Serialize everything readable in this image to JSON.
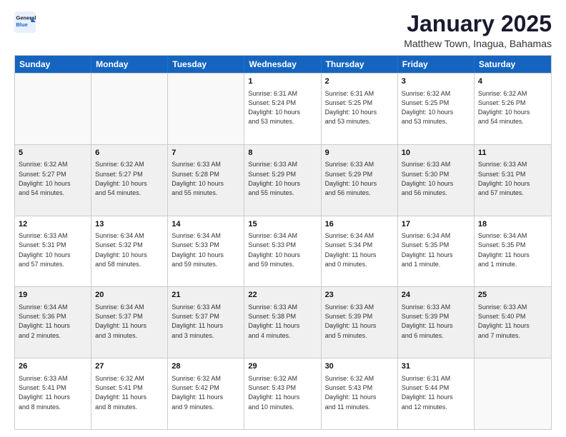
{
  "logo": {
    "line1": "General",
    "line2": "Blue"
  },
  "title": "January 2025",
  "subtitle": "Matthew Town, Inagua, Bahamas",
  "days": [
    "Sunday",
    "Monday",
    "Tuesday",
    "Wednesday",
    "Thursday",
    "Friday",
    "Saturday"
  ],
  "rows": [
    [
      {
        "day": "",
        "info": "",
        "shaded": false,
        "empty": true
      },
      {
        "day": "",
        "info": "",
        "shaded": false,
        "empty": true
      },
      {
        "day": "",
        "info": "",
        "shaded": false,
        "empty": true
      },
      {
        "day": "1",
        "info": "Sunrise: 6:31 AM\nSunset: 5:24 PM\nDaylight: 10 hours\nand 53 minutes.",
        "shaded": false,
        "empty": false
      },
      {
        "day": "2",
        "info": "Sunrise: 6:31 AM\nSunset: 5:25 PM\nDaylight: 10 hours\nand 53 minutes.",
        "shaded": false,
        "empty": false
      },
      {
        "day": "3",
        "info": "Sunrise: 6:32 AM\nSunset: 5:25 PM\nDaylight: 10 hours\nand 53 minutes.",
        "shaded": false,
        "empty": false
      },
      {
        "day": "4",
        "info": "Sunrise: 6:32 AM\nSunset: 5:26 PM\nDaylight: 10 hours\nand 54 minutes.",
        "shaded": false,
        "empty": false
      }
    ],
    [
      {
        "day": "5",
        "info": "Sunrise: 6:32 AM\nSunset: 5:27 PM\nDaylight: 10 hours\nand 54 minutes.",
        "shaded": true,
        "empty": false
      },
      {
        "day": "6",
        "info": "Sunrise: 6:32 AM\nSunset: 5:27 PM\nDaylight: 10 hours\nand 54 minutes.",
        "shaded": true,
        "empty": false
      },
      {
        "day": "7",
        "info": "Sunrise: 6:33 AM\nSunset: 5:28 PM\nDaylight: 10 hours\nand 55 minutes.",
        "shaded": true,
        "empty": false
      },
      {
        "day": "8",
        "info": "Sunrise: 6:33 AM\nSunset: 5:29 PM\nDaylight: 10 hours\nand 55 minutes.",
        "shaded": true,
        "empty": false
      },
      {
        "day": "9",
        "info": "Sunrise: 6:33 AM\nSunset: 5:29 PM\nDaylight: 10 hours\nand 56 minutes.",
        "shaded": true,
        "empty": false
      },
      {
        "day": "10",
        "info": "Sunrise: 6:33 AM\nSunset: 5:30 PM\nDaylight: 10 hours\nand 56 minutes.",
        "shaded": true,
        "empty": false
      },
      {
        "day": "11",
        "info": "Sunrise: 6:33 AM\nSunset: 5:31 PM\nDaylight: 10 hours\nand 57 minutes.",
        "shaded": true,
        "empty": false
      }
    ],
    [
      {
        "day": "12",
        "info": "Sunrise: 6:33 AM\nSunset: 5:31 PM\nDaylight: 10 hours\nand 57 minutes.",
        "shaded": false,
        "empty": false
      },
      {
        "day": "13",
        "info": "Sunrise: 6:34 AM\nSunset: 5:32 PM\nDaylight: 10 hours\nand 58 minutes.",
        "shaded": false,
        "empty": false
      },
      {
        "day": "14",
        "info": "Sunrise: 6:34 AM\nSunset: 5:33 PM\nDaylight: 10 hours\nand 59 minutes.",
        "shaded": false,
        "empty": false
      },
      {
        "day": "15",
        "info": "Sunrise: 6:34 AM\nSunset: 5:33 PM\nDaylight: 10 hours\nand 59 minutes.",
        "shaded": false,
        "empty": false
      },
      {
        "day": "16",
        "info": "Sunrise: 6:34 AM\nSunset: 5:34 PM\nDaylight: 11 hours\nand 0 minutes.",
        "shaded": false,
        "empty": false
      },
      {
        "day": "17",
        "info": "Sunrise: 6:34 AM\nSunset: 5:35 PM\nDaylight: 11 hours\nand 1 minute.",
        "shaded": false,
        "empty": false
      },
      {
        "day": "18",
        "info": "Sunrise: 6:34 AM\nSunset: 5:35 PM\nDaylight: 11 hours\nand 1 minute.",
        "shaded": false,
        "empty": false
      }
    ],
    [
      {
        "day": "19",
        "info": "Sunrise: 6:34 AM\nSunset: 5:36 PM\nDaylight: 11 hours\nand 2 minutes.",
        "shaded": true,
        "empty": false
      },
      {
        "day": "20",
        "info": "Sunrise: 6:34 AM\nSunset: 5:37 PM\nDaylight: 11 hours\nand 3 minutes.",
        "shaded": true,
        "empty": false
      },
      {
        "day": "21",
        "info": "Sunrise: 6:33 AM\nSunset: 5:37 PM\nDaylight: 11 hours\nand 3 minutes.",
        "shaded": true,
        "empty": false
      },
      {
        "day": "22",
        "info": "Sunrise: 6:33 AM\nSunset: 5:38 PM\nDaylight: 11 hours\nand 4 minutes.",
        "shaded": true,
        "empty": false
      },
      {
        "day": "23",
        "info": "Sunrise: 6:33 AM\nSunset: 5:39 PM\nDaylight: 11 hours\nand 5 minutes.",
        "shaded": true,
        "empty": false
      },
      {
        "day": "24",
        "info": "Sunrise: 6:33 AM\nSunset: 5:39 PM\nDaylight: 11 hours\nand 6 minutes.",
        "shaded": true,
        "empty": false
      },
      {
        "day": "25",
        "info": "Sunrise: 6:33 AM\nSunset: 5:40 PM\nDaylight: 11 hours\nand 7 minutes.",
        "shaded": true,
        "empty": false
      }
    ],
    [
      {
        "day": "26",
        "info": "Sunrise: 6:33 AM\nSunset: 5:41 PM\nDaylight: 11 hours\nand 8 minutes.",
        "shaded": false,
        "empty": false
      },
      {
        "day": "27",
        "info": "Sunrise: 6:32 AM\nSunset: 5:41 PM\nDaylight: 11 hours\nand 8 minutes.",
        "shaded": false,
        "empty": false
      },
      {
        "day": "28",
        "info": "Sunrise: 6:32 AM\nSunset: 5:42 PM\nDaylight: 11 hours\nand 9 minutes.",
        "shaded": false,
        "empty": false
      },
      {
        "day": "29",
        "info": "Sunrise: 6:32 AM\nSunset: 5:43 PM\nDaylight: 11 hours\nand 10 minutes.",
        "shaded": false,
        "empty": false
      },
      {
        "day": "30",
        "info": "Sunrise: 6:32 AM\nSunset: 5:43 PM\nDaylight: 11 hours\nand 11 minutes.",
        "shaded": false,
        "empty": false
      },
      {
        "day": "31",
        "info": "Sunrise: 6:31 AM\nSunset: 5:44 PM\nDaylight: 11 hours\nand 12 minutes.",
        "shaded": false,
        "empty": false
      },
      {
        "day": "",
        "info": "",
        "shaded": false,
        "empty": true
      }
    ]
  ]
}
